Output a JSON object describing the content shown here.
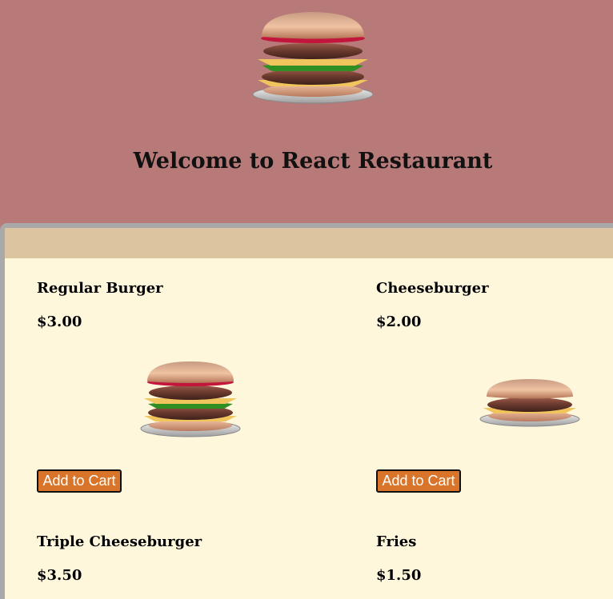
{
  "header": {
    "title": "Welcome to React Restaurant",
    "logo_icon": "burger-icon"
  },
  "menu": {
    "items": [
      {
        "name": "Regular Burger",
        "price": "$3.00",
        "image": "triple-burger-image",
        "button_label": "Add to Cart"
      },
      {
        "name": "Cheeseburger",
        "price": "$2.00",
        "image": "single-burger-image",
        "button_label": "Add to Cart"
      },
      {
        "name": "Triple Cheeseburger",
        "price": "$3.50"
      },
      {
        "name": "Fries",
        "price": "$1.50"
      }
    ]
  },
  "colors": {
    "page_background": "#b87a78",
    "menu_header": "#dcc4a1",
    "menu_background": "#fff7dc",
    "button": "#d8752b"
  }
}
